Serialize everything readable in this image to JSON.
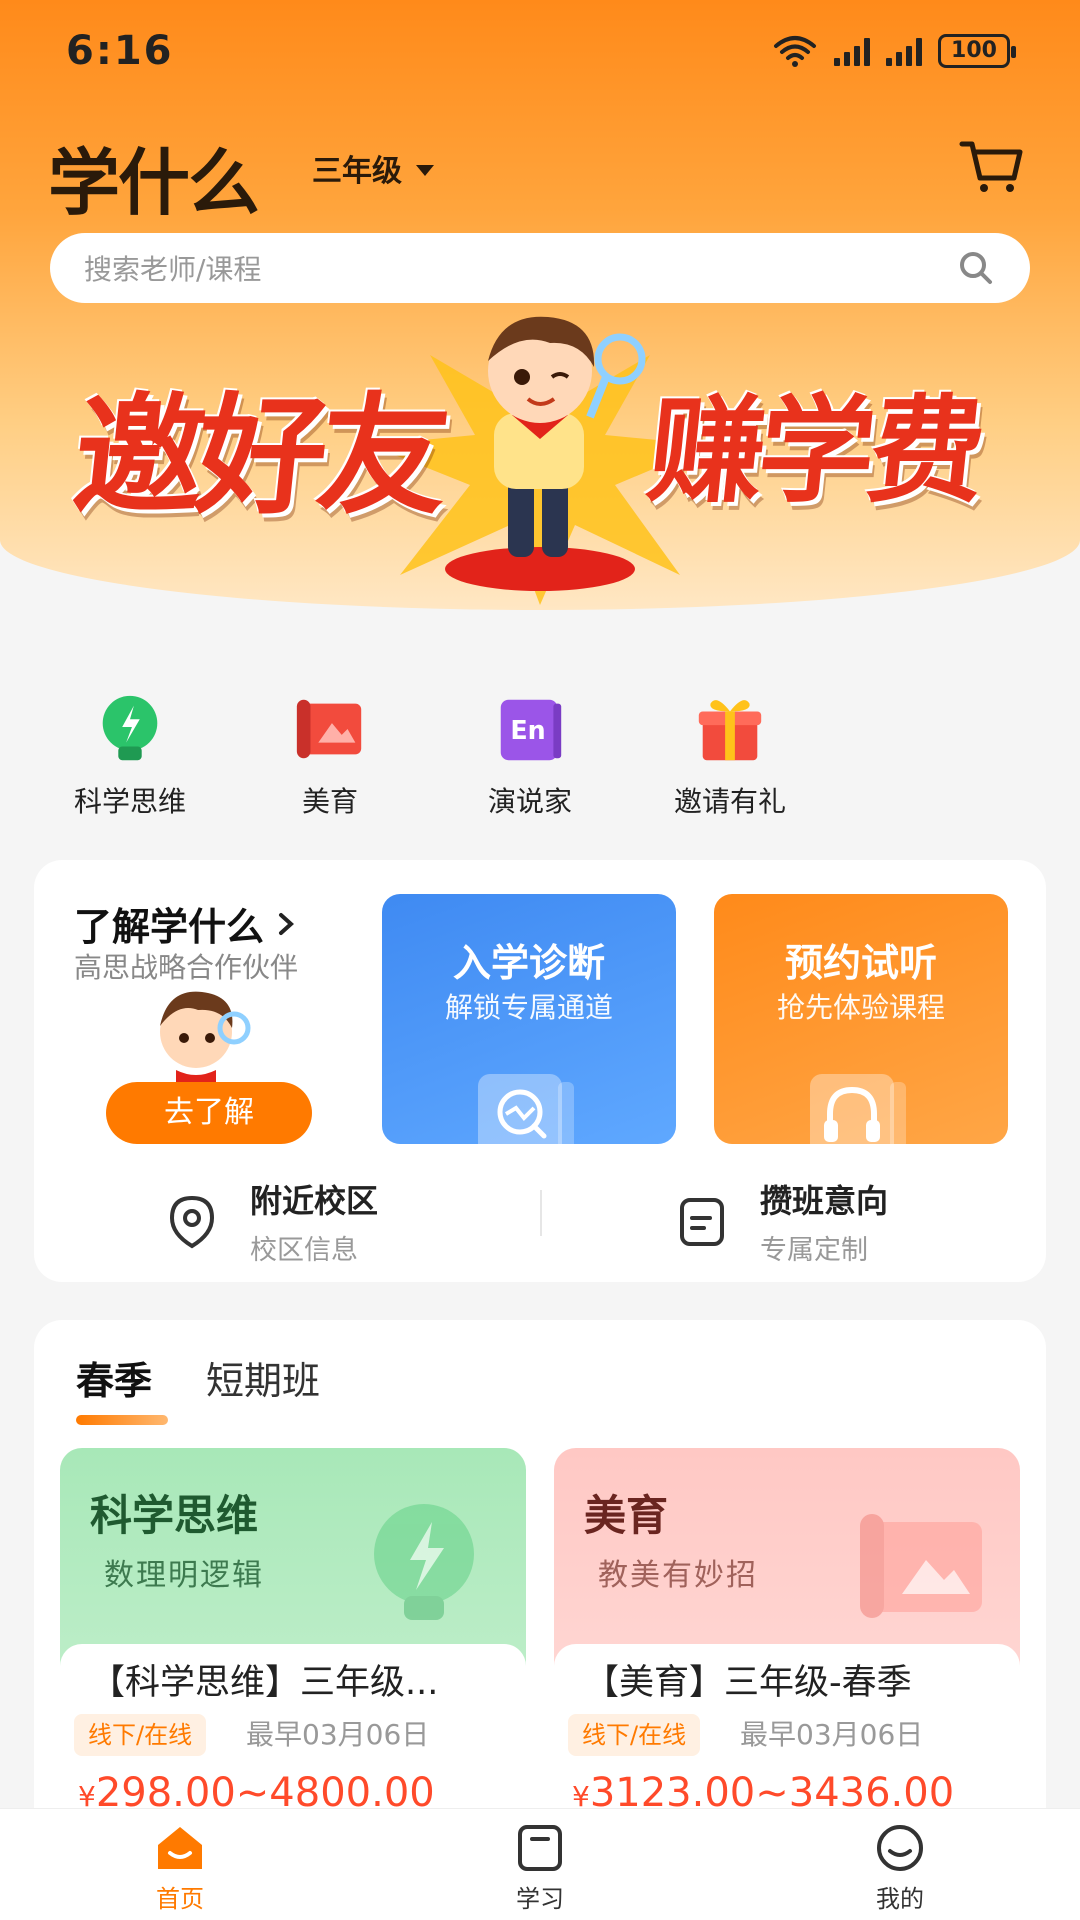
{
  "status_bar": {
    "time": "6:16",
    "battery": "100"
  },
  "header": {
    "app_title": "学什么",
    "grade": "三年级"
  },
  "search": {
    "placeholder": "搜索老师/课程"
  },
  "banner": {
    "left_text": "邀好友",
    "right_text": "赚学费"
  },
  "categories": [
    {
      "label": "科学思维",
      "icon": "lightbulb-icon"
    },
    {
      "label": "美育",
      "icon": "art-scroll-icon"
    },
    {
      "label": "演说家",
      "icon": "en-book-icon"
    },
    {
      "label": "邀请有礼",
      "icon": "gift-icon"
    }
  ],
  "about": {
    "title": "了解学什么",
    "subtitle": "高思战略合作伙伴",
    "button": "去了解"
  },
  "tiles": [
    {
      "title": "入学诊断",
      "subtitle": "解锁专属通道",
      "color": "#3f8af2"
    },
    {
      "title": "预约试听",
      "subtitle": "抢先体验课程",
      "color": "#ff8a1a"
    }
  ],
  "entries": [
    {
      "title": "附近校区",
      "subtitle": "校区信息",
      "icon": "location-pin-icon"
    },
    {
      "title": "攒班意向",
      "subtitle": "专属定制",
      "icon": "note-icon"
    }
  ],
  "course_tabs": [
    {
      "label": "春季",
      "active": true
    },
    {
      "label": "短期班",
      "active": false
    }
  ],
  "courses": [
    {
      "head": "科学思维",
      "sub": "数理明逻辑",
      "title": "【科学思维】三年级...",
      "tag": "线下/在线",
      "date": "最早03月06日",
      "price_symbol": "¥",
      "price": "298.00~4800.00"
    },
    {
      "head": "美育",
      "sub": "教美有妙招",
      "title": "【美育】三年级-春季",
      "tag": "线下/在线",
      "date": "最早03月06日",
      "price_symbol": "¥",
      "price": "3123.00~3436.00"
    }
  ],
  "bottom_nav": [
    {
      "label": "首页",
      "active": true
    },
    {
      "label": "学习",
      "active": false
    },
    {
      "label": "我的",
      "active": false
    }
  ],
  "colors": {
    "accent": "#ff7a00",
    "price": "#ff4a2a",
    "blue_tile": "#3f8af2"
  }
}
